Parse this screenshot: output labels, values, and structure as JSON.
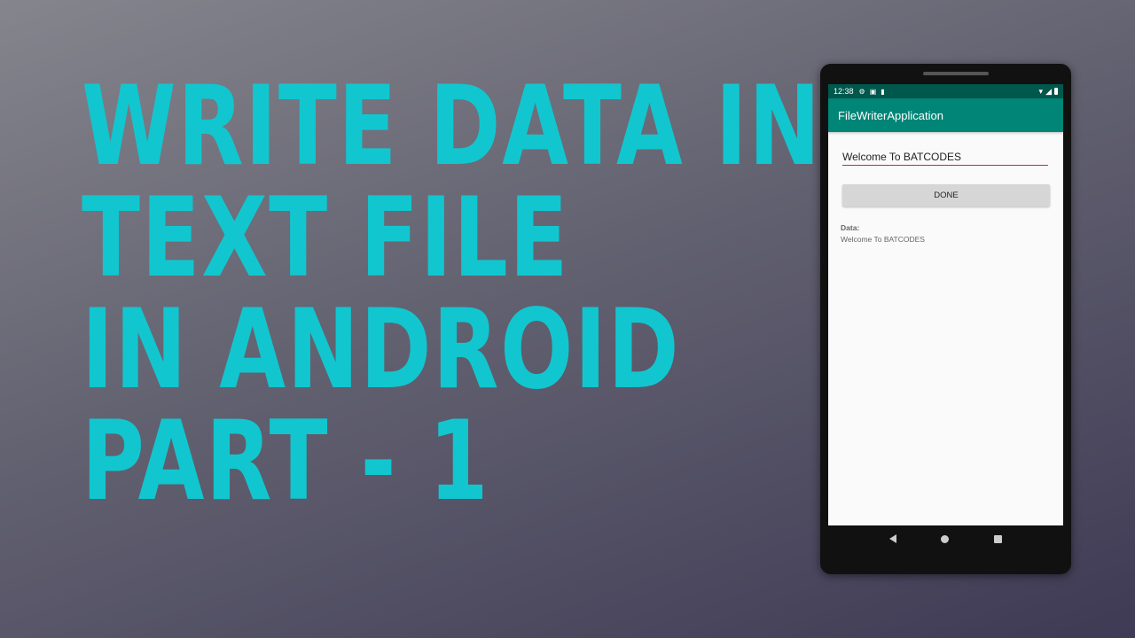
{
  "headline": {
    "lines": [
      "WRITE DATA IN",
      "TEXT FILE",
      "IN ANDROID",
      "PART - 1"
    ]
  },
  "colors": {
    "headline": "#12c6cf",
    "app_bar": "#008577",
    "status_bar": "#00574b",
    "accent": "#d81b60"
  },
  "phone": {
    "status_bar": {
      "time": "12:38",
      "icons": [
        "settings-icon",
        "image-icon",
        "sd-card-icon",
        "wifi-icon",
        "signal-icon",
        "battery-icon"
      ]
    },
    "app_bar": {
      "title": "FileWriterApplication"
    },
    "edit_text": {
      "value": "Welcome To BATCODES"
    },
    "done_button": {
      "label": "DONE"
    },
    "data_label": "Data:",
    "data_value": "Welcome To BATCODES",
    "nav_bar": [
      "back-icon",
      "home-icon",
      "recents-icon"
    ]
  }
}
